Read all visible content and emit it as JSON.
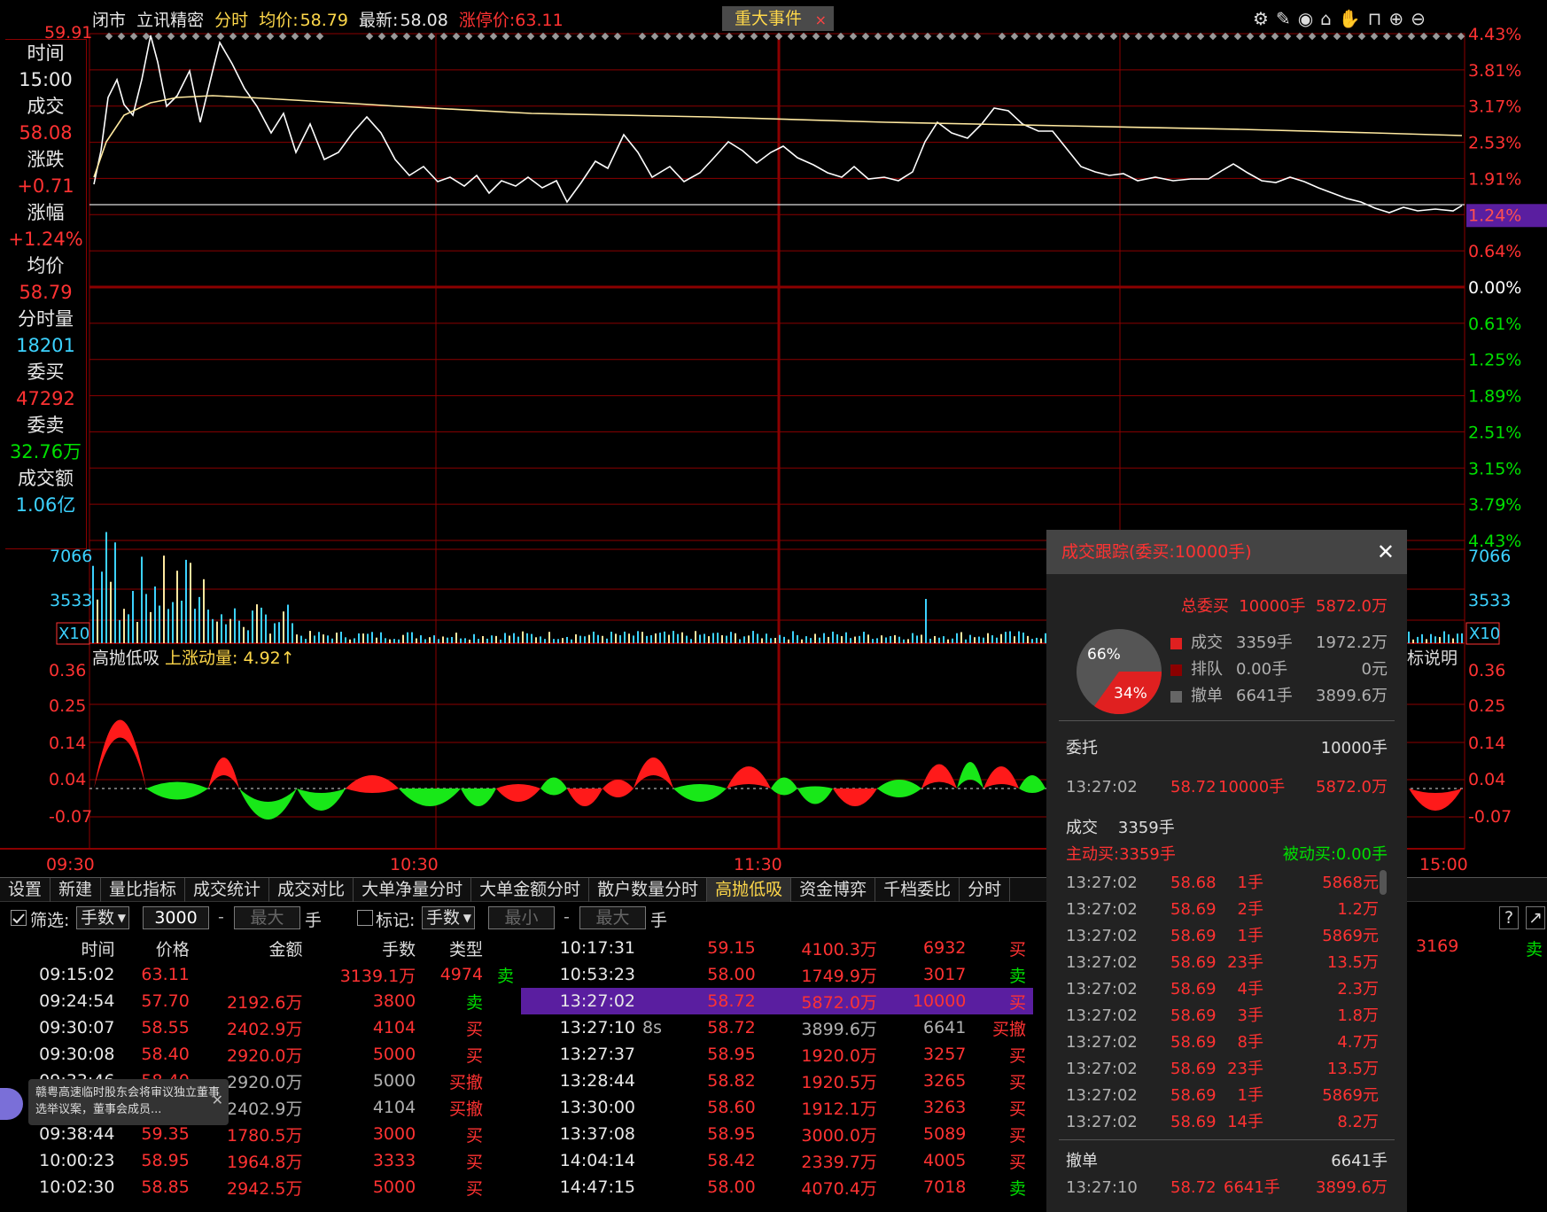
{
  "header": {
    "status": "闭市",
    "stock_name": "立讯精密",
    "mode": "分时",
    "avg_label": "均价:",
    "avg_value": "58.79",
    "latest_label": "最新:",
    "latest_value": "58.08",
    "limit_up": "涨停价:63.11",
    "event_button": "重大事件",
    "close_x": "×"
  },
  "colors": {
    "up": "#ff3232",
    "down": "#00e000",
    "price_line": "#ffffff",
    "avg_line": "#ffe9a0",
    "grid": "#8b0000",
    "volume": "#3cd2ff",
    "highlight": "#5a1ea0"
  },
  "price_axis": {
    "top_price": "59.91",
    "right_labels": [
      "4.43%",
      "3.81%",
      "3.17%",
      "2.53%",
      "1.91%",
      "1.24%",
      "0.64%",
      "0.00%",
      "0.61%",
      "1.25%",
      "1.89%",
      "2.51%",
      "3.15%",
      "3.79%",
      "4.43%"
    ]
  },
  "left_panel": [
    {
      "label": "时间",
      "value": "15:00",
      "color": "wht"
    },
    {
      "label": "成交",
      "value": "58.08",
      "color": "red"
    },
    {
      "label": "涨跌",
      "value": "+0.71",
      "color": "red"
    },
    {
      "label": "涨幅",
      "value": "+1.24%",
      "color": "red"
    },
    {
      "label": "均价",
      "value": "58.79",
      "color": "red"
    },
    {
      "label": "分时量",
      "value": "18201",
      "color": "cyan"
    },
    {
      "label": "委买",
      "value": "47292",
      "color": "red"
    },
    {
      "label": "委卖",
      "value": "32.76万",
      "color": "grn"
    },
    {
      "label": "成交额",
      "value": "1.06亿",
      "color": "cyan"
    }
  ],
  "volume_axis": {
    "labels": [
      "7066",
      "3533"
    ],
    "multiplier": "X10"
  },
  "indicator": {
    "name": "高抛低吸",
    "param": "上涨动量:",
    "param_value": "4.92",
    "labels": [
      "0.36",
      "0.25",
      "0.14",
      "0.04",
      "-0.07"
    ],
    "explain": "标说明"
  },
  "time_axis": [
    "09:30",
    "10:30",
    "11:30",
    "15:00"
  ],
  "tabs": [
    "设置",
    "新建",
    "量比指标",
    "成交统计",
    "成交对比",
    "大单净量分时",
    "大单金额分时",
    "散户数量分时",
    "高抛低吸",
    "资金博弈",
    "千档委比",
    "分时"
  ],
  "active_tab": "高抛低吸",
  "filter": {
    "filter_label": "筛选:",
    "unit1": "手数",
    "value1": "3000",
    "max_placeholder": "最大",
    "hand": "手",
    "mark_label": "标记:",
    "unit2": "手数",
    "min_placeholder": "最小",
    "dash": "-"
  },
  "left_table": {
    "headers": [
      "时间",
      "价格",
      "金额",
      "手数",
      "类型"
    ],
    "rows": [
      {
        "time": "09:15:02",
        "price": "63.11",
        "amount": "3139.1万",
        "vol": "4974",
        "type": "卖",
        "tc": "grn",
        "pc": "red",
        "flag": true
      },
      {
        "time": "09:24:54",
        "price": "57.70",
        "amount": "2192.6万",
        "vol": "3800",
        "type": "卖",
        "tc": "grn",
        "pc": "red"
      },
      {
        "time": "09:30:07",
        "price": "58.55",
        "amount": "2402.9万",
        "vol": "4104",
        "type": "买",
        "tc": "red",
        "pc": "red"
      },
      {
        "time": "09:30:08",
        "price": "58.40",
        "amount": "2920.0万",
        "vol": "5000",
        "type": "买",
        "tc": "red",
        "pc": "red"
      },
      {
        "time": "09:33:46",
        "price": "58.40",
        "amount": "2920.0万",
        "vol": "5000",
        "type": "买撤",
        "tc": "red",
        "pc": "red",
        "dim": true
      },
      {
        "time": "",
        "price": "",
        "amount": "2402.9万",
        "vol": "4104",
        "type": "买撤",
        "tc": "red",
        "pc": "red",
        "dim": true
      },
      {
        "time": "09:38:44",
        "price": "59.35",
        "amount": "1780.5万",
        "vol": "3000",
        "type": "买",
        "tc": "red",
        "pc": "red"
      },
      {
        "time": "10:00:23",
        "price": "58.95",
        "amount": "1964.8万",
        "vol": "3333",
        "type": "买",
        "tc": "red",
        "pc": "red"
      },
      {
        "time": "10:02:30",
        "price": "58.85",
        "amount": "2942.5万",
        "vol": "5000",
        "type": "买",
        "tc": "red",
        "pc": "red"
      }
    ]
  },
  "mid_table": [
    {
      "time": "10:17:31",
      "tag": "",
      "price": "59.15",
      "amount": "4100.3万",
      "vol": "6932",
      "type": "买",
      "tc": "red"
    },
    {
      "time": "10:53:23",
      "tag": "",
      "price": "58.00",
      "amount": "1749.9万",
      "vol": "3017",
      "type": "卖",
      "tc": "grn"
    },
    {
      "time": "13:27:02",
      "tag": "",
      "price": "58.72",
      "amount": "5872.0万",
      "vol": "10000",
      "type": "买",
      "tc": "red",
      "hl": true
    },
    {
      "time": "13:27:10",
      "tag": "8s",
      "price": "58.72",
      "amount": "3899.6万",
      "vol": "6641",
      "type": "买撤",
      "tc": "red",
      "dim": true
    },
    {
      "time": "13:27:37",
      "tag": "",
      "price": "58.95",
      "amount": "1920.0万",
      "vol": "3257",
      "type": "买",
      "tc": "red"
    },
    {
      "time": "13:28:44",
      "tag": "",
      "price": "58.82",
      "amount": "1920.5万",
      "vol": "3265",
      "type": "买",
      "tc": "red"
    },
    {
      "time": "13:30:00",
      "tag": "",
      "price": "58.60",
      "amount": "1912.1万",
      "vol": "3263",
      "type": "买",
      "tc": "red"
    },
    {
      "time": "13:37:08",
      "tag": "",
      "price": "58.95",
      "amount": "3000.0万",
      "vol": "5089",
      "type": "买",
      "tc": "red"
    },
    {
      "time": "14:04:14",
      "tag": "",
      "price": "58.42",
      "amount": "2339.7万",
      "vol": "4005",
      "type": "买",
      "tc": "red"
    },
    {
      "time": "14:47:15",
      "tag": "",
      "price": "58.00",
      "amount": "4070.4万",
      "vol": "7018",
      "type": "卖",
      "tc": "grn"
    }
  ],
  "right_extra": {
    "vol": "3169",
    "type": "卖"
  },
  "toast": {
    "text": "赣粤高速临时股东会将审议独立董事选举议案，董事会成员..."
  },
  "popup": {
    "title": "成交跟踪(委买:10000手)",
    "total_label": "总委买",
    "total_vol": "10000手",
    "total_amt": "5872.0万",
    "pie_big": "66%",
    "pie_small": "34%",
    "legend": [
      {
        "label": "成交",
        "vol": "3359手",
        "amt": "1972.2万",
        "color": "#e02020"
      },
      {
        "label": "排队",
        "vol": "0.00手",
        "amt": "0元",
        "color": "#8b0000"
      },
      {
        "label": "撤单",
        "vol": "6641手",
        "amt": "3899.6万",
        "color": "#666666"
      }
    ],
    "order_label": "委托",
    "order_total": "10000手",
    "order_row": {
      "time": "13:27:02",
      "price": "58.72",
      "vol": "10000手",
      "amt": "5872.0万"
    },
    "deal_label": "成交",
    "deal_total": "3359手",
    "active_buy": "主动买:3359手",
    "passive_buy": "被动买:0.00手",
    "deals": [
      {
        "time": "13:27:02",
        "price": "58.68",
        "vol": "1手",
        "amt": "5868元"
      },
      {
        "time": "13:27:02",
        "price": "58.69",
        "vol": "2手",
        "amt": "1.2万"
      },
      {
        "time": "13:27:02",
        "price": "58.69",
        "vol": "1手",
        "amt": "5869元"
      },
      {
        "time": "13:27:02",
        "price": "58.69",
        "vol": "23手",
        "amt": "13.5万"
      },
      {
        "time": "13:27:02",
        "price": "58.69",
        "vol": "4手",
        "amt": "2.3万"
      },
      {
        "time": "13:27:02",
        "price": "58.69",
        "vol": "3手",
        "amt": "1.8万"
      },
      {
        "time": "13:27:02",
        "price": "58.69",
        "vol": "8手",
        "amt": "4.7万"
      },
      {
        "time": "13:27:02",
        "price": "58.69",
        "vol": "23手",
        "amt": "13.5万"
      },
      {
        "time": "13:27:02",
        "price": "58.69",
        "vol": "1手",
        "amt": "5869元"
      },
      {
        "time": "13:27:02",
        "price": "58.69",
        "vol": "14手",
        "amt": "8.2万"
      }
    ],
    "cancel_label": "撤单",
    "cancel_total": "6641手",
    "cancel_row": {
      "time": "13:27:10",
      "price": "58.72",
      "vol": "6641手",
      "amt": "3899.6万"
    }
  }
}
